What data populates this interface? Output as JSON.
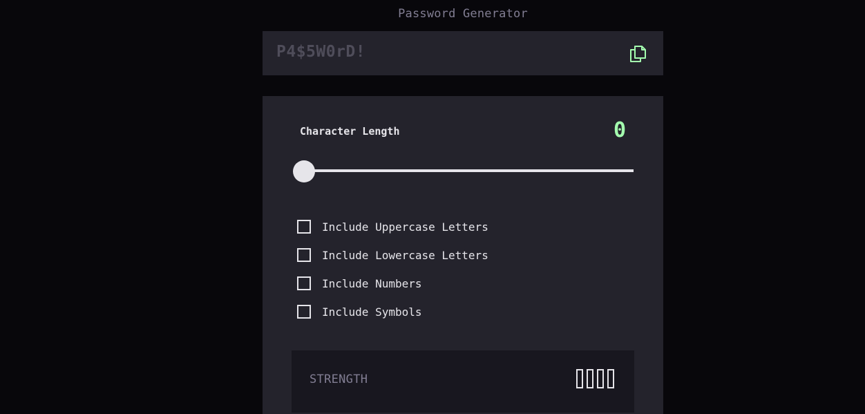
{
  "app": {
    "title": "Password Generator"
  },
  "password": {
    "text": "P4$5W0rD!",
    "copy_icon": "copy-icon"
  },
  "length": {
    "label": "Character Length",
    "value": "0",
    "slider_fraction": 0
  },
  "options": [
    {
      "label": "Include Uppercase Letters",
      "checked": false
    },
    {
      "label": "Include Lowercase Letters",
      "checked": false
    },
    {
      "label": "Include Numbers",
      "checked": false
    },
    {
      "label": "Include Symbols",
      "checked": false
    }
  ],
  "strength": {
    "label": "STRENGTH",
    "filled_bars": 0,
    "total_bars": 4
  },
  "colors": {
    "accent": "#a4ffaf",
    "panel": "#24232c",
    "background": "#08070b",
    "muted": "#817d92",
    "text": "#e6e5ea"
  }
}
